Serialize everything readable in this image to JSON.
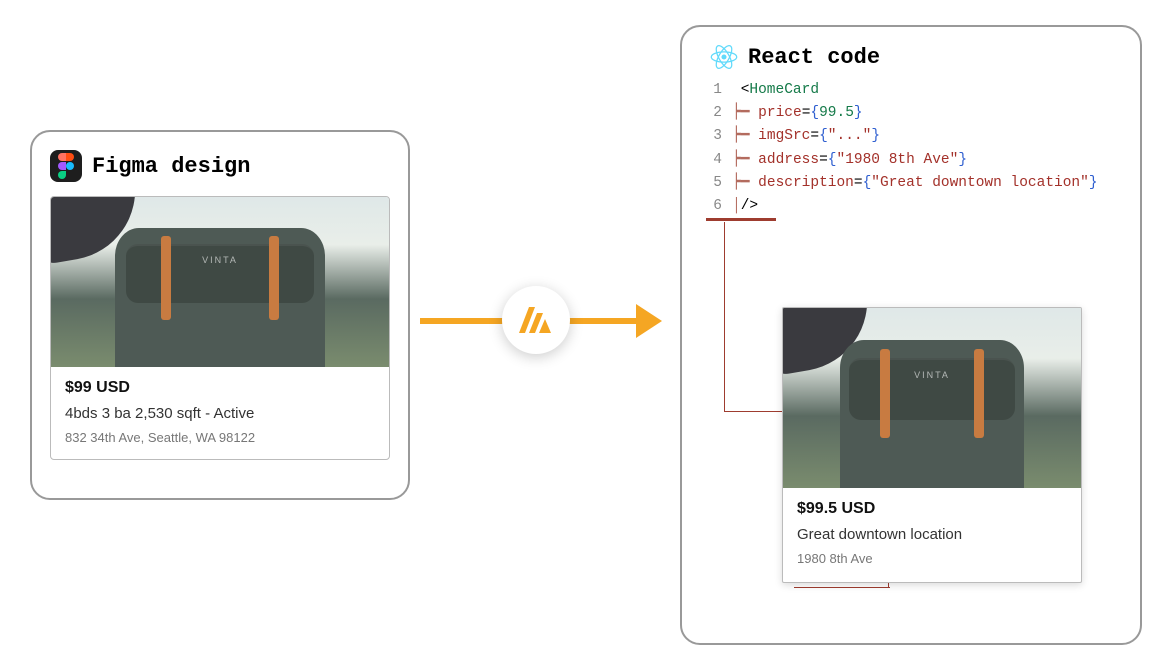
{
  "left": {
    "title": "Figma design",
    "brand_label": "VINTA",
    "card": {
      "price": "$99 USD",
      "desc": "4bds 3 ba 2,530 sqft - Active",
      "addr": "832 34th Ave, Seattle, WA 98122"
    }
  },
  "right": {
    "title": "React code",
    "code": {
      "lines": [
        "1",
        "2",
        "3",
        "4",
        "5",
        "6"
      ],
      "component": "HomeCard",
      "price_attr": "price",
      "price_val": "99.5",
      "imgSrc_attr": "imgSrc",
      "imgSrc_val": "\"...\"",
      "address_attr": "address",
      "address_val": "\"1980 8th Ave\"",
      "description_attr": "description",
      "description_val": "\"Great downtown location\""
    },
    "card": {
      "price": "$99.5 USD",
      "desc": "Great downtown location",
      "addr": "1980 8th Ave"
    }
  }
}
